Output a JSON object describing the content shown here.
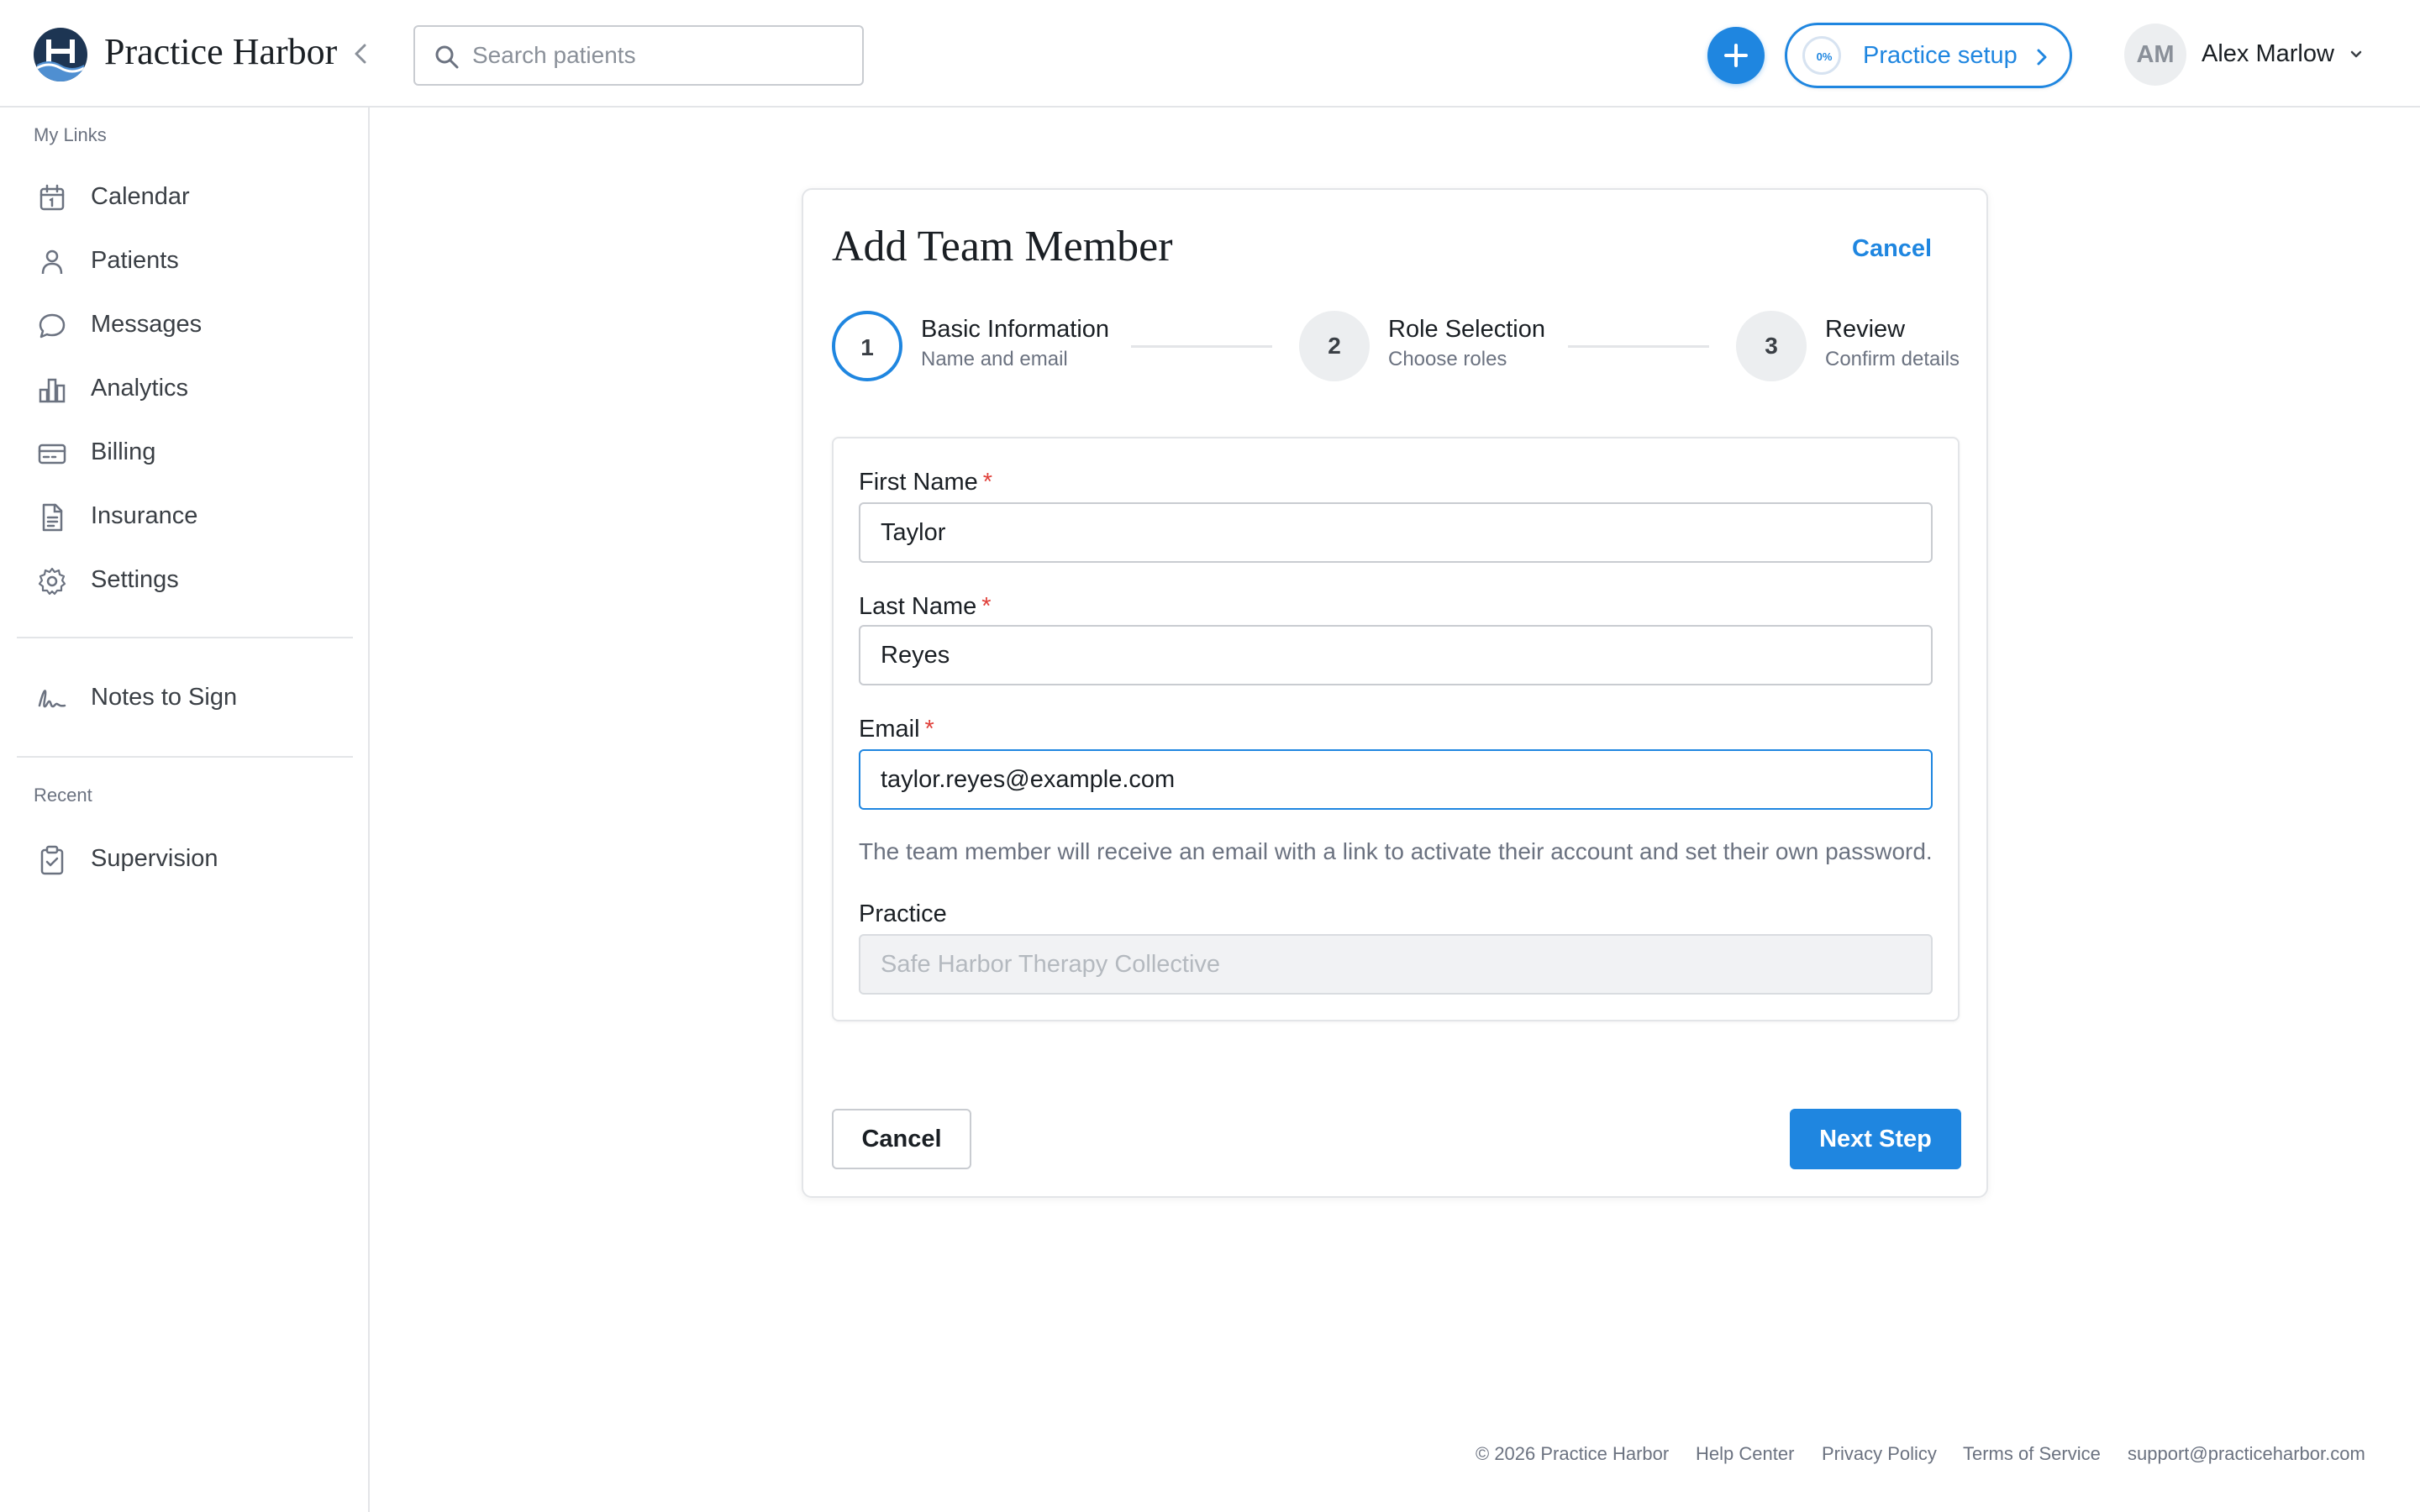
{
  "header": {
    "brand": "Practice Harbor",
    "search_placeholder": "Search patients",
    "setup_label": "Practice setup",
    "setup_progress": "0%",
    "user_initials": "AM",
    "user_name": "Alex Marlow"
  },
  "sidebar": {
    "my_links_label": "My Links",
    "items": [
      {
        "label": "Calendar",
        "icon": "calendar-icon"
      },
      {
        "label": "Patients",
        "icon": "user-icon"
      },
      {
        "label": "Messages",
        "icon": "message-icon"
      },
      {
        "label": "Analytics",
        "icon": "bar-chart-icon"
      },
      {
        "label": "Billing",
        "icon": "credit-card-icon"
      },
      {
        "label": "Insurance",
        "icon": "document-icon"
      },
      {
        "label": "Settings",
        "icon": "gear-icon"
      }
    ],
    "notes_to_sign": "Notes to Sign",
    "recent_label": "Recent",
    "recent_items": [
      {
        "label": "Supervision",
        "icon": "clipboard-check-icon"
      }
    ]
  },
  "card": {
    "title": "Add Team Member",
    "cancel_link": "Cancel",
    "steps": [
      {
        "number": "1",
        "title": "Basic Information",
        "subtitle": "Name and email",
        "state": "active"
      },
      {
        "number": "2",
        "title": "Role Selection",
        "subtitle": "Choose roles",
        "state": "inactive"
      },
      {
        "number": "3",
        "title": "Review",
        "subtitle": "Confirm details",
        "state": "inactive"
      }
    ],
    "form": {
      "first_name_label": "First Name",
      "first_name_value": "Taylor",
      "last_name_label": "Last Name",
      "last_name_value": "Reyes",
      "email_label": "Email",
      "email_value": "taylor.reyes@example.com",
      "required_mark": "*",
      "helper_text": "The team member will receive an email with a link to activate their account and set their own password.",
      "practice_label": "Practice",
      "practice_value": "Safe Harbor Therapy Collective"
    },
    "cancel_button": "Cancel",
    "next_button": "Next Step"
  },
  "footer": {
    "copyright": "© 2026 Practice Harbor",
    "help": "Help Center",
    "privacy": "Privacy Policy",
    "terms": "Terms of Service",
    "support_email": "support@practiceharbor.com"
  },
  "colors": {
    "accent": "#1f86e0",
    "required": "#e0403a",
    "brand_dark": "#1d3553"
  }
}
